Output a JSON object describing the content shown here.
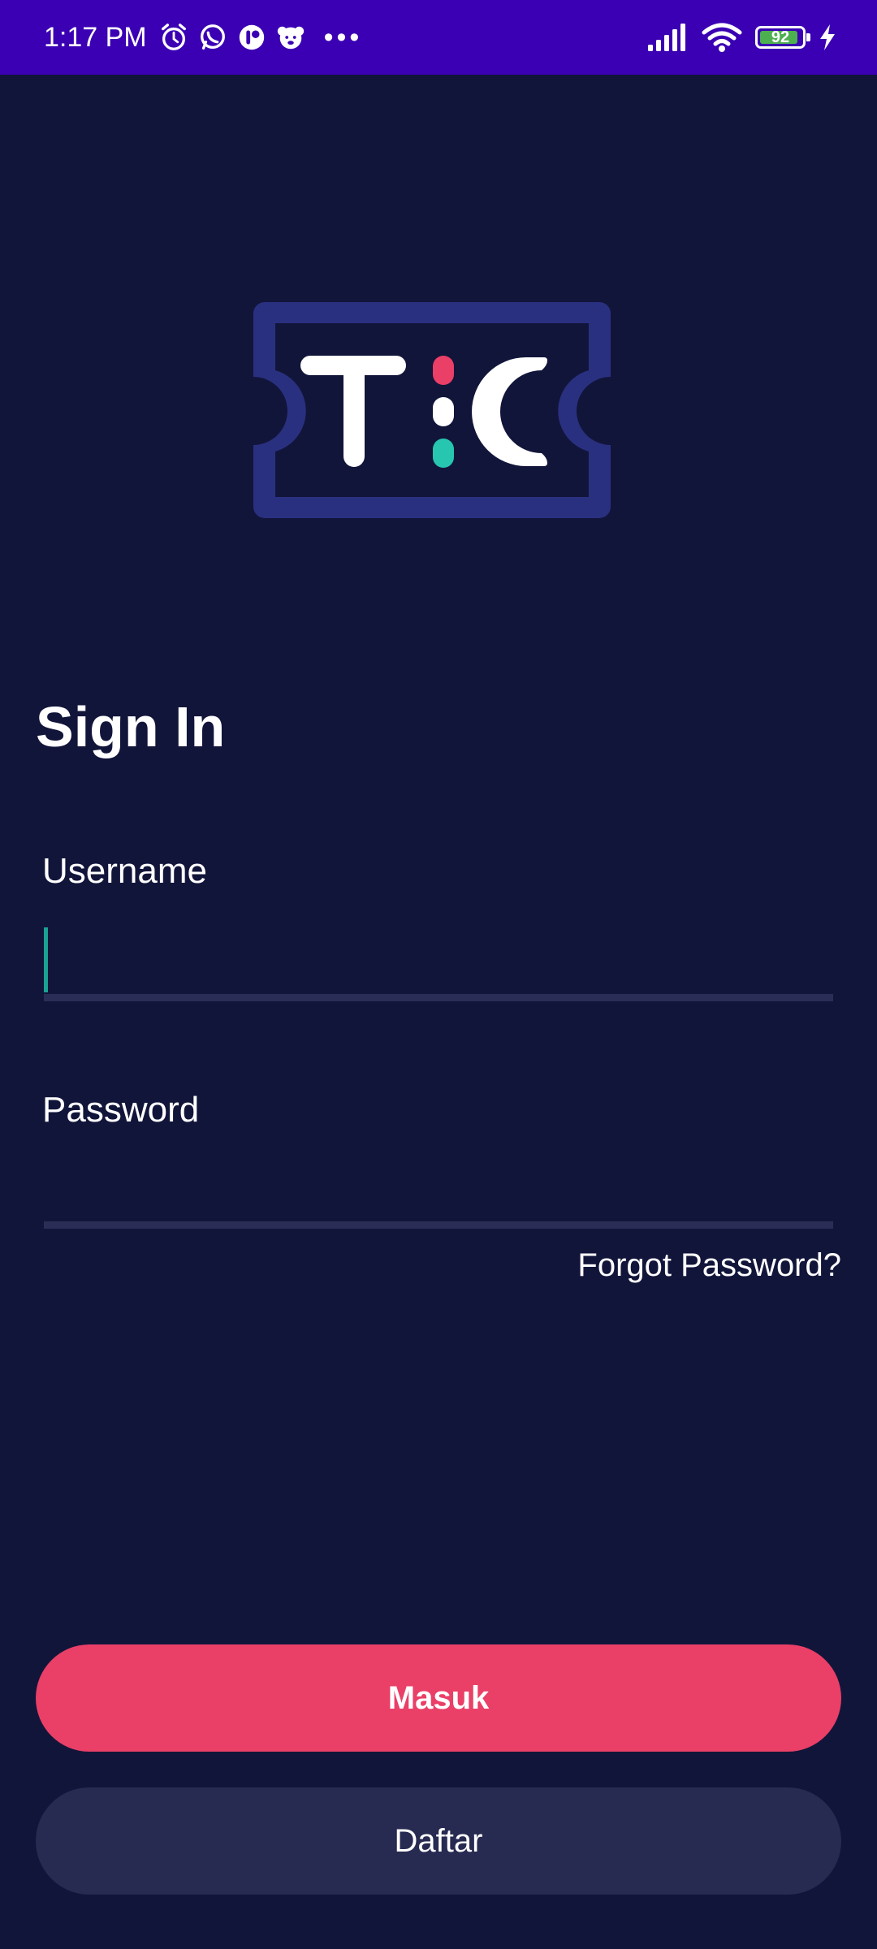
{
  "status_bar": {
    "time": "1:17 PM",
    "battery_level": "92",
    "icons": [
      "alarm-icon",
      "whatsapp-icon",
      "app-icon",
      "pet-app-icon",
      "more-dots-icon",
      "signal-icon",
      "wifi-icon",
      "battery-icon",
      "charging-icon"
    ]
  },
  "logo": {
    "letters": [
      "T",
      "C"
    ]
  },
  "sign_in": {
    "title": "Sign In",
    "username_label": "Username",
    "username_value": "",
    "password_label": "Password",
    "password_value": "",
    "forgot_password": "Forgot Password?"
  },
  "buttons": {
    "login": "Masuk",
    "register": "Daftar"
  },
  "colors": {
    "background": "#12153a",
    "status_bar": "#3b00b3",
    "accent": "#ea3f67",
    "secondary_button": "#272a51",
    "logo_frame": "#2a3080",
    "cursor": "#1aa392",
    "dot_teal": "#26c6b0"
  }
}
